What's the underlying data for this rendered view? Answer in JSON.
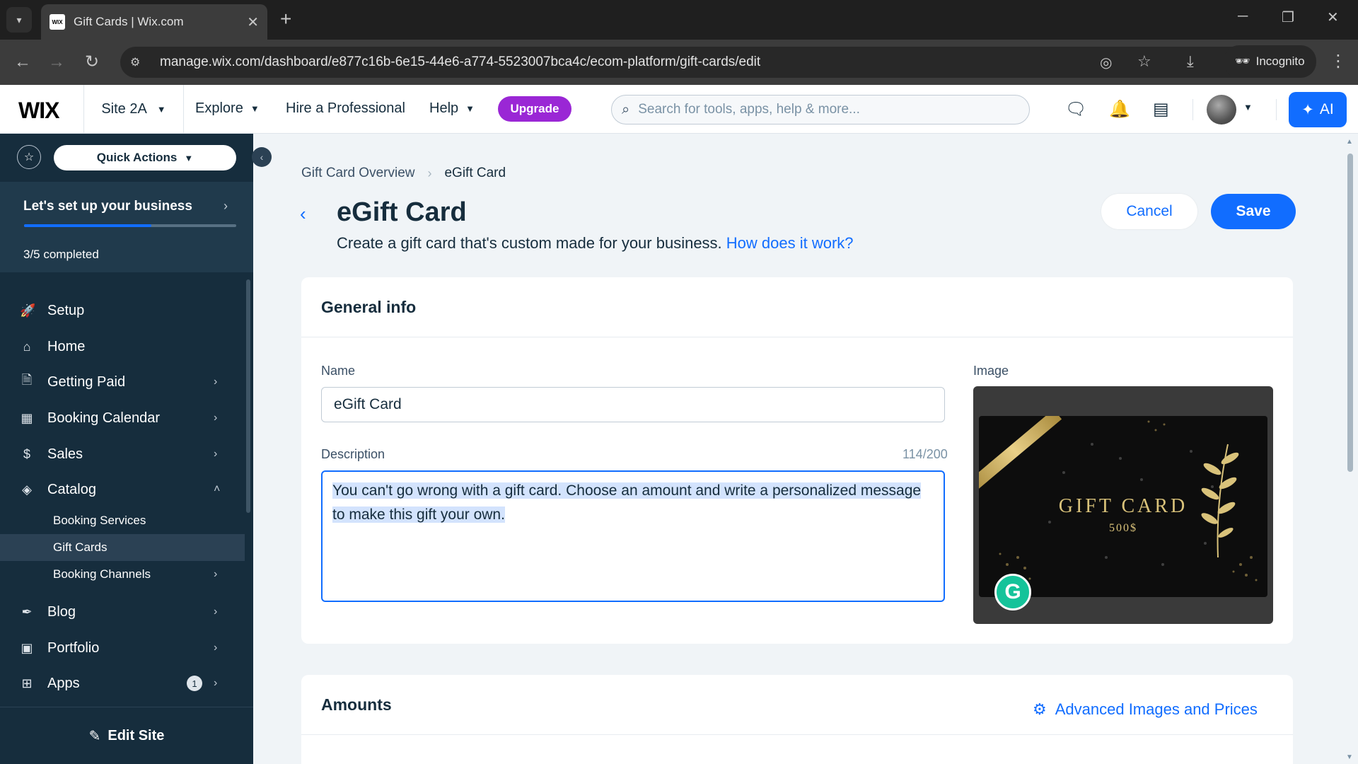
{
  "browser": {
    "tab_title": "Gift Cards | Wix.com",
    "favicon_text": "WIX",
    "url": "manage.wix.com/dashboard/e877c16b-6e15-44e6-a774-5523007bca4c/ecom-platform/gift-cards/edit",
    "incognito_label": "Incognito"
  },
  "topbar": {
    "logo": "WIX",
    "site_name": "Site 2A",
    "explore": "Explore",
    "hire": "Hire a Professional",
    "help": "Help",
    "upgrade": "Upgrade",
    "search_placeholder": "Search for tools, apps, help & more...",
    "ai_label": "AI"
  },
  "sidebar": {
    "quick_actions": "Quick Actions",
    "setup_title": "Let's set up your business",
    "setup_progress": 0.6,
    "setup_count": "3/5 completed",
    "items": [
      {
        "label": "Setup",
        "icon": "rocket-icon"
      },
      {
        "label": "Home",
        "icon": "home-icon"
      },
      {
        "label": "Getting Paid",
        "icon": "invoice-icon"
      },
      {
        "label": "Booking Calendar",
        "icon": "calendar-icon"
      },
      {
        "label": "Sales",
        "icon": "dollar-icon"
      },
      {
        "label": "Catalog",
        "icon": "catalog-icon"
      }
    ],
    "catalog_sub": [
      {
        "label": "Booking Services"
      },
      {
        "label": "Gift Cards"
      },
      {
        "label": "Booking Channels"
      }
    ],
    "items_bottom": [
      {
        "label": "Blog",
        "icon": "pen-icon"
      },
      {
        "label": "Portfolio",
        "icon": "portfolio-icon"
      },
      {
        "label": "Apps",
        "icon": "apps-icon",
        "badge": "1"
      }
    ],
    "edit_site": "Edit Site"
  },
  "page": {
    "breadcrumb_parent": "Gift Card Overview",
    "breadcrumb_current": "eGift Card",
    "title": "eGift Card",
    "subtitle": "Create a gift card that's custom made for your business.",
    "subtitle_link": "How does it work?",
    "cancel": "Cancel",
    "save": "Save"
  },
  "general_info": {
    "heading": "General info",
    "name_label": "Name",
    "name_value": "eGift Card",
    "description_label": "Description",
    "description_counter": "114/200",
    "description_value": "You can't go wrong with a gift card. Choose an amount and write a personalized message to make this gift your own.",
    "image_label": "Image",
    "card_title": "GIFT CARD",
    "card_amount": "500$"
  },
  "amounts": {
    "heading": "Amounts",
    "advanced_link": "Advanced Images and Prices"
  },
  "colors": {
    "accent": "#116dff",
    "sidebar_bg": "#162d3d",
    "upgrade": "#9a27d5"
  }
}
